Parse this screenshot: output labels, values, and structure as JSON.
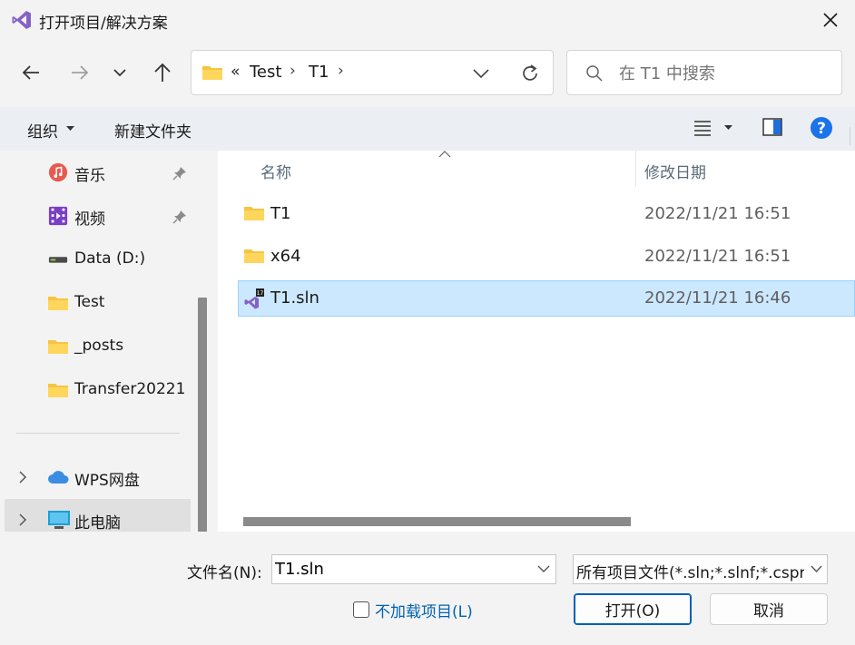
{
  "window": {
    "title": "打开项目/解决方案",
    "accent": "#005fb8",
    "selection_bg": "#cce8ff"
  },
  "nav": {
    "back_icon": "arrow-left-icon",
    "forward_icon": "arrow-right-icon",
    "recent_icon": "chevron-down-icon",
    "up_icon": "arrow-up-icon"
  },
  "address": {
    "overflow": "«",
    "crumbs": [
      "Test",
      "T1"
    ]
  },
  "search": {
    "placeholder": "在 T1 中搜索"
  },
  "toolbar": {
    "organize": "组织",
    "new_folder": "新建文件夹"
  },
  "sidebar": {
    "items": [
      {
        "label": "音乐",
        "icon": "music-icon",
        "pinned": true
      },
      {
        "label": "视频",
        "icon": "video-icon",
        "pinned": true
      },
      {
        "label": "Data (D:)",
        "icon": "drive-icon"
      },
      {
        "label": "Test",
        "icon": "folder-icon"
      },
      {
        "label": "_posts",
        "icon": "folder-icon"
      },
      {
        "label": "Transfer20221",
        "icon": "folder-icon"
      },
      {
        "label": "WPS网盘",
        "icon": "cloud-icon"
      },
      {
        "label": "此电脑",
        "icon": "computer-icon"
      }
    ]
  },
  "columns": {
    "name": "名称",
    "date": "修改日期"
  },
  "files": [
    {
      "name": "T1",
      "date": "2022/11/21 16:51",
      "type": "folder"
    },
    {
      "name": "x64",
      "date": "2022/11/21 16:51",
      "type": "folder"
    },
    {
      "name": "T1.sln",
      "date": "2022/11/21 16:46",
      "type": "solution",
      "selected": true
    }
  ],
  "footer": {
    "filename_label": "文件名(N):",
    "filename_value": "T1.sln",
    "filter_value": "所有项目文件(*.sln;*.slnf;*.cspr",
    "no_load_label": "不加载项目(L)",
    "open_button": "打开(O)",
    "cancel_button": "取消"
  }
}
